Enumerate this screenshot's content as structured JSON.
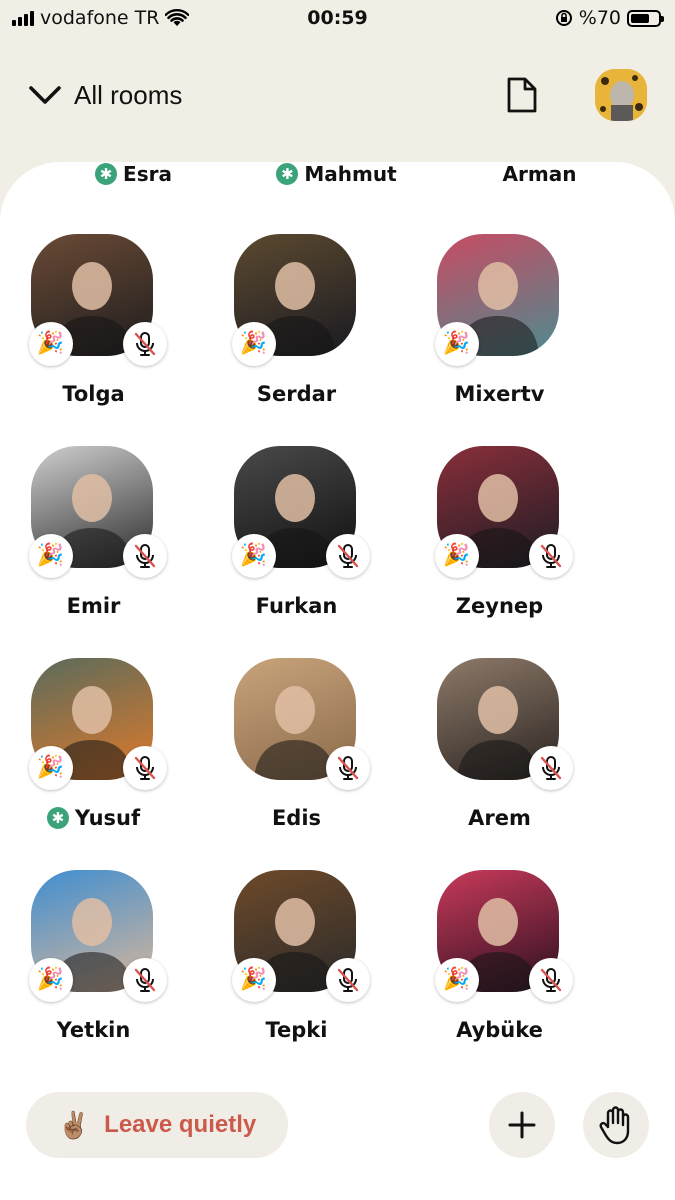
{
  "status_bar": {
    "carrier": "vodafone TR",
    "time": "00:59",
    "battery_text": "%70",
    "battery_level": 0.7
  },
  "header": {
    "title": "All rooms",
    "chevron_icon": "chevron-down-icon",
    "document_icon": "document-icon"
  },
  "top_names": [
    {
      "name": "Esra",
      "moderator": true
    },
    {
      "name": "Mahmut",
      "moderator": true
    },
    {
      "name": "Arman",
      "moderator": false
    }
  ],
  "speakers": [
    {
      "name": "Tolga",
      "moderator": false,
      "party": true,
      "muted": true,
      "colors": [
        "#6b4a36",
        "#1d1d1d"
      ]
    },
    {
      "name": "Serdar",
      "moderator": false,
      "party": true,
      "muted": false,
      "colors": [
        "#5c4a2f",
        "#1a1a22"
      ]
    },
    {
      "name": "Mixertv",
      "moderator": false,
      "party": true,
      "muted": false,
      "colors": [
        "#c84b63",
        "#4d8b8f"
      ]
    },
    {
      "name": "Emir",
      "moderator": false,
      "party": true,
      "muted": true,
      "colors": [
        "#cfcfcf",
        "#2b2b2b"
      ]
    },
    {
      "name": "Furkan",
      "moderator": false,
      "party": true,
      "muted": true,
      "colors": [
        "#4a4a4a",
        "#101010"
      ]
    },
    {
      "name": "Zeynep",
      "moderator": false,
      "party": true,
      "muted": true,
      "colors": [
        "#8a2f3a",
        "#1c1c24"
      ]
    },
    {
      "name": "Yusuf",
      "moderator": true,
      "party": true,
      "muted": true,
      "colors": [
        "#5a6b5c",
        "#e07a2a"
      ]
    },
    {
      "name": "Edis",
      "moderator": false,
      "party": false,
      "muted": true,
      "colors": [
        "#c9a47c",
        "#8a6a4a"
      ]
    },
    {
      "name": "Arem",
      "moderator": false,
      "party": false,
      "muted": true,
      "colors": [
        "#8e7a6a",
        "#2a2420"
      ]
    },
    {
      "name": "Yetkin",
      "moderator": false,
      "party": true,
      "muted": true,
      "colors": [
        "#3f8ed1",
        "#d9b79a"
      ]
    },
    {
      "name": "Tepki",
      "moderator": false,
      "party": true,
      "muted": true,
      "colors": [
        "#6e4a2a",
        "#2a2a2a"
      ]
    },
    {
      "name": "Aybüke",
      "moderator": false,
      "party": true,
      "muted": true,
      "colors": [
        "#c93a5a",
        "#2a1020"
      ]
    }
  ],
  "bottom": {
    "leave_label": "Leave quietly",
    "leave_emoji": "✌🏽",
    "add_icon": "plus-icon",
    "raise_hand_icon": "raise-hand-icon"
  },
  "colors": {
    "background": "#f1efe5",
    "panel": "#ffffff",
    "leave_text": "#cc5a4c",
    "moderator_badge": "#3aa37a",
    "mute_slash": "#d9534f"
  }
}
